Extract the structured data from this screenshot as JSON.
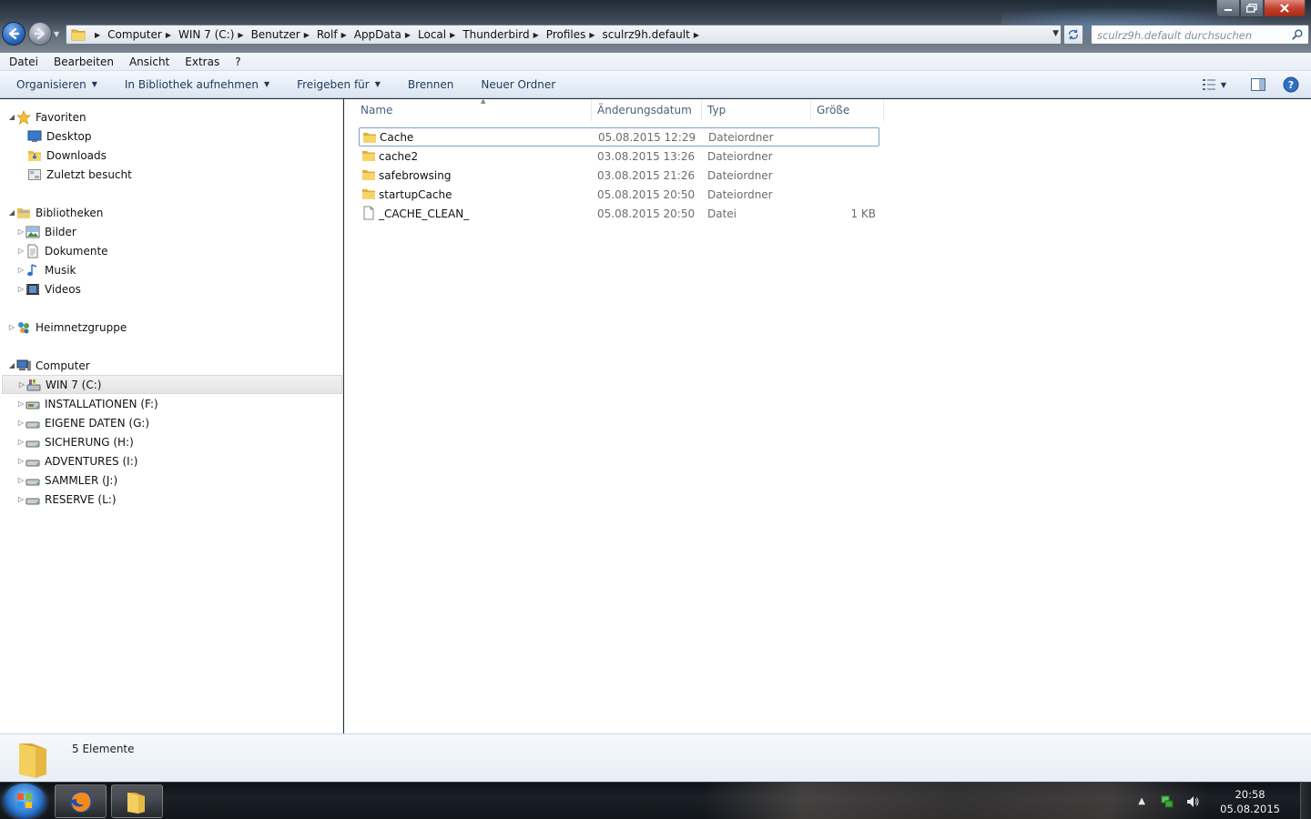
{
  "address_bar": {
    "crumbs": [
      "Computer",
      "WIN 7 (C:)",
      "Benutzer",
      "Rolf",
      "AppData",
      "Local",
      "Thunderbird",
      "Profiles",
      "sculrz9h.default"
    ],
    "search_placeholder": "sculrz9h.default durchsuchen"
  },
  "menu": [
    "Datei",
    "Bearbeiten",
    "Ansicht",
    "Extras",
    "?"
  ],
  "toolbar": {
    "organize": "Organisieren",
    "library": "In Bibliothek aufnehmen",
    "share": "Freigeben für",
    "burn": "Brennen",
    "new_folder": "Neuer Ordner"
  },
  "nav": {
    "favorites": "Favoriten",
    "favorites_items": [
      "Desktop",
      "Downloads",
      "Zuletzt besucht"
    ],
    "libraries": "Bibliotheken",
    "library_items": [
      "Bilder",
      "Dokumente",
      "Musik",
      "Videos"
    ],
    "homegroup": "Heimnetzgruppe",
    "computer": "Computer",
    "drives": [
      "WIN 7 (C:)",
      "INSTALLATIONEN (F:)",
      "EIGENE DATEN (G:)",
      "SICHERUNG (H:)",
      "ADVENTURES (I:)",
      "SAMMLER (J:)",
      "RESERVE (L:)"
    ]
  },
  "columns": [
    "Name",
    "Änderungsdatum",
    "Typ",
    "Größe"
  ],
  "files": [
    {
      "name": "Cache",
      "date": "05.08.2015 12:29",
      "type": "Dateiordner",
      "size": "",
      "icon": "folder-icon"
    },
    {
      "name": "cache2",
      "date": "03.08.2015 13:26",
      "type": "Dateiordner",
      "size": "",
      "icon": "folder-icon"
    },
    {
      "name": "safebrowsing",
      "date": "03.08.2015 21:26",
      "type": "Dateiordner",
      "size": "",
      "icon": "folder-icon"
    },
    {
      "name": "startupCache",
      "date": "05.08.2015 20:50",
      "type": "Dateiordner",
      "size": "",
      "icon": "folder-icon"
    },
    {
      "name": "_CACHE_CLEAN_",
      "date": "05.08.2015 20:50",
      "type": "Datei",
      "size": "1 KB",
      "icon": "file-icon"
    }
  ],
  "status": {
    "count": "5 Elemente"
  },
  "taskbar": {
    "time": "20:58",
    "date": "05.08.2015"
  }
}
